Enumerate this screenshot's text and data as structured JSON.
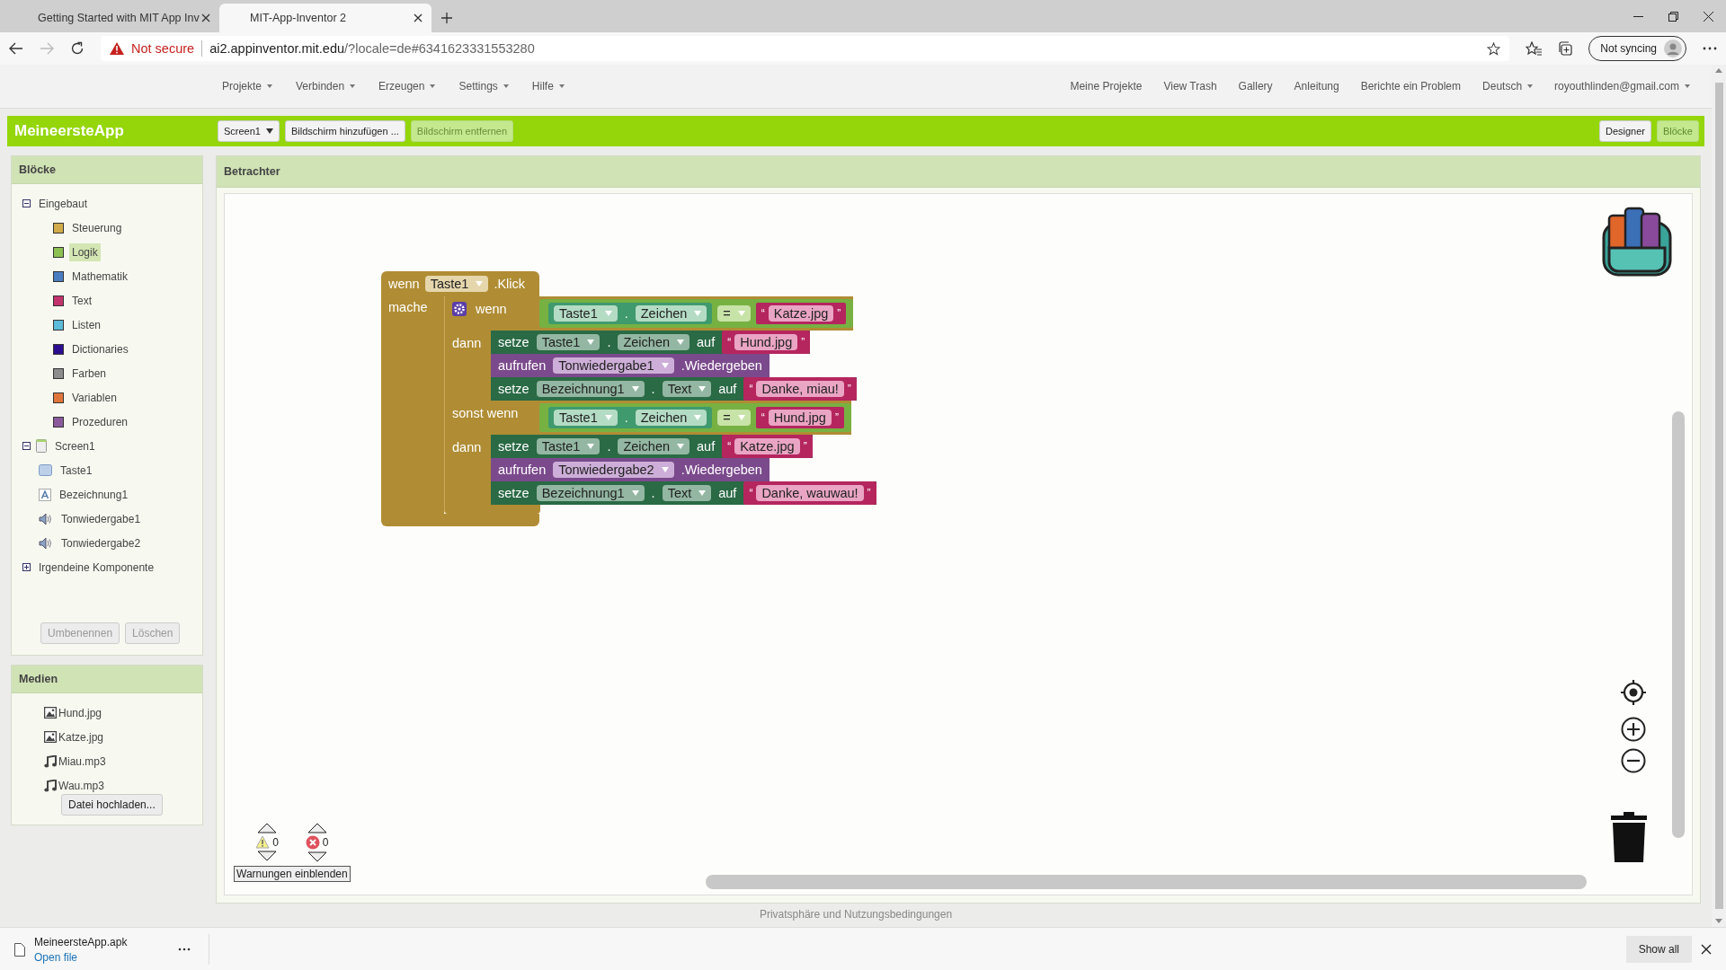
{
  "browser": {
    "tabs": [
      {
        "title": "Getting Started with MIT App Inv",
        "selected": false
      },
      {
        "title": "MIT-App-Inventor 2",
        "selected": true
      }
    ],
    "security": "Not secure",
    "url_host": "ai2.appinventor.mit.edu",
    "url_path": "/?locale=de#6341623331553280",
    "profile": "Not syncing"
  },
  "app_nav": {
    "menus": [
      {
        "label": "Projekte",
        "dropdown": true
      },
      {
        "label": "Verbinden",
        "dropdown": true
      },
      {
        "label": "Erzeugen",
        "dropdown": true
      },
      {
        "label": "Settings",
        "dropdown": true
      },
      {
        "label": "Hilfe",
        "dropdown": true
      }
    ],
    "links": [
      {
        "label": "Meine Projekte",
        "dropdown": false
      },
      {
        "label": "View Trash",
        "dropdown": false
      },
      {
        "label": "Gallery",
        "dropdown": false
      },
      {
        "label": "Anleitung",
        "dropdown": false
      },
      {
        "label": "Berichte ein Problem",
        "dropdown": false
      },
      {
        "label": "Deutsch",
        "dropdown": true
      },
      {
        "label": "royouthlinden@gmail.com",
        "dropdown": true
      }
    ]
  },
  "toolbar": {
    "app_name": "MeineersteApp",
    "screen": "Screen1",
    "buttons": [
      {
        "label": "Bildschirm hinzufügen ...",
        "disabled": false
      },
      {
        "label": "Bildschirm entfernen",
        "disabled": true
      }
    ],
    "views": [
      {
        "label": "Designer",
        "selected": false
      },
      {
        "label": "Blöcke",
        "selected": true
      }
    ]
  },
  "blocks_panel": {
    "title": "Blöcke",
    "tree": [
      {
        "label": "Eingebaut",
        "expanded": true,
        "children": [
          {
            "label": "Steuerung",
            "color": "#d1ab4a",
            "selected": false
          },
          {
            "label": "Logik",
            "color": "#8cc152",
            "selected": true
          },
          {
            "label": "Mathematik",
            "color": "#4a7cc0",
            "selected": false
          },
          {
            "label": "Text",
            "color": "#c2326c",
            "selected": false
          },
          {
            "label": "Listen",
            "color": "#5bbbd8",
            "selected": false
          },
          {
            "label": "Dictionaries",
            "color": "#2c0d8f",
            "selected": false
          },
          {
            "label": "Farben",
            "color": "#8c8c8c",
            "selected": false
          },
          {
            "label": "Variablen",
            "color": "#e0753b",
            "selected": false
          },
          {
            "label": "Prozeduren",
            "color": "#8a5a9c",
            "selected": false
          }
        ]
      },
      {
        "label": "Screen1",
        "kind": "screen",
        "expanded": true,
        "children": [
          {
            "label": "Taste1",
            "kind": "button",
            "selected": false
          },
          {
            "label": "Bezeichnung1",
            "kind": "label",
            "selected": false
          },
          {
            "label": "Tonwiedergabe1",
            "kind": "sound",
            "selected": false
          },
          {
            "label": "Tonwiedergabe2",
            "kind": "sound",
            "selected": false
          }
        ]
      },
      {
        "label": "Irgendeine Komponente",
        "expanded": false
      }
    ],
    "buttons": [
      {
        "label": "Umbenennen",
        "disabled": true
      },
      {
        "label": "Löschen",
        "disabled": true
      }
    ]
  },
  "media_panel": {
    "title": "Medien",
    "files": [
      {
        "name": "Hund.jpg",
        "kind": "image"
      },
      {
        "name": "Katze.jpg",
        "kind": "image"
      },
      {
        "name": "Miau.mp3",
        "kind": "audio"
      },
      {
        "name": "Wau.mp3",
        "kind": "audio"
      }
    ],
    "upload": "Datei hochladen..."
  },
  "viewer": {
    "title": "Betrachter",
    "event_block": {
      "keyword": "wenn",
      "component": "Taste1",
      "event": ".Klick",
      "do_label": "mache",
      "body": {
        "kind": "if",
        "mutator": true,
        "clauses": [
          {
            "kind": "condition",
            "label": "wenn",
            "test": {
              "component": "Taste1",
              "separator": ".",
              "property": "Zeichen",
              "operator": "=",
              "open_quote": "“",
              "text": "Katze.jpg",
              "close_quote": "”"
            }
          },
          {
            "kind": "statements",
            "label": "dann",
            "statements": [
              {
                "kind": "set",
                "keyword": "setze",
                "component": "Taste1",
                "separator": ".",
                "property": "Zeichen",
                "to": "auf",
                "open_quote": "“",
                "text": "Hund.jpg",
                "close_quote": "”"
              },
              {
                "kind": "call",
                "keyword": "aufrufen",
                "component": "Tonwiedergabe1",
                "method": ".Wiedergeben"
              },
              {
                "kind": "set",
                "keyword": "setze",
                "component": "Bezeichnung1",
                "separator": ".",
                "property": "Text",
                "to": "auf",
                "open_quote": "“",
                "text": "Danke, miau!",
                "close_quote": "”"
              }
            ]
          },
          {
            "kind": "condition",
            "label": "sonst wenn",
            "test": {
              "component": "Taste1",
              "separator": ".",
              "property": "Zeichen",
              "operator": "=",
              "open_quote": "“",
              "text": "Hund.jpg",
              "close_quote": "”"
            }
          },
          {
            "kind": "statements",
            "label": "dann",
            "statements": [
              {
                "kind": "set",
                "keyword": "setze",
                "component": "Taste1",
                "separator": ".",
                "property": "Zeichen",
                "to": "auf",
                "open_quote": "“",
                "text": "Katze.jpg",
                "close_quote": "”"
              },
              {
                "kind": "call",
                "keyword": "aufrufen",
                "component": "Tonwiedergabe2",
                "method": ".Wiedergeben"
              },
              {
                "kind": "set",
                "keyword": "setze",
                "component": "Bezeichnung1",
                "separator": ".",
                "property": "Text",
                "to": "auf",
                "open_quote": "“",
                "text": "Danke, wauwau!",
                "close_quote": "”"
              }
            ]
          }
        ]
      }
    },
    "warnings": {
      "count": "0"
    },
    "errors": {
      "count": "0"
    },
    "toggle": "Warnungen einblenden"
  },
  "footer": "Privatsphäre und Nutzungsbedingungen",
  "downloads": {
    "file": "MeineersteApp.apk",
    "action": "Open file",
    "show_all": "Show all"
  }
}
